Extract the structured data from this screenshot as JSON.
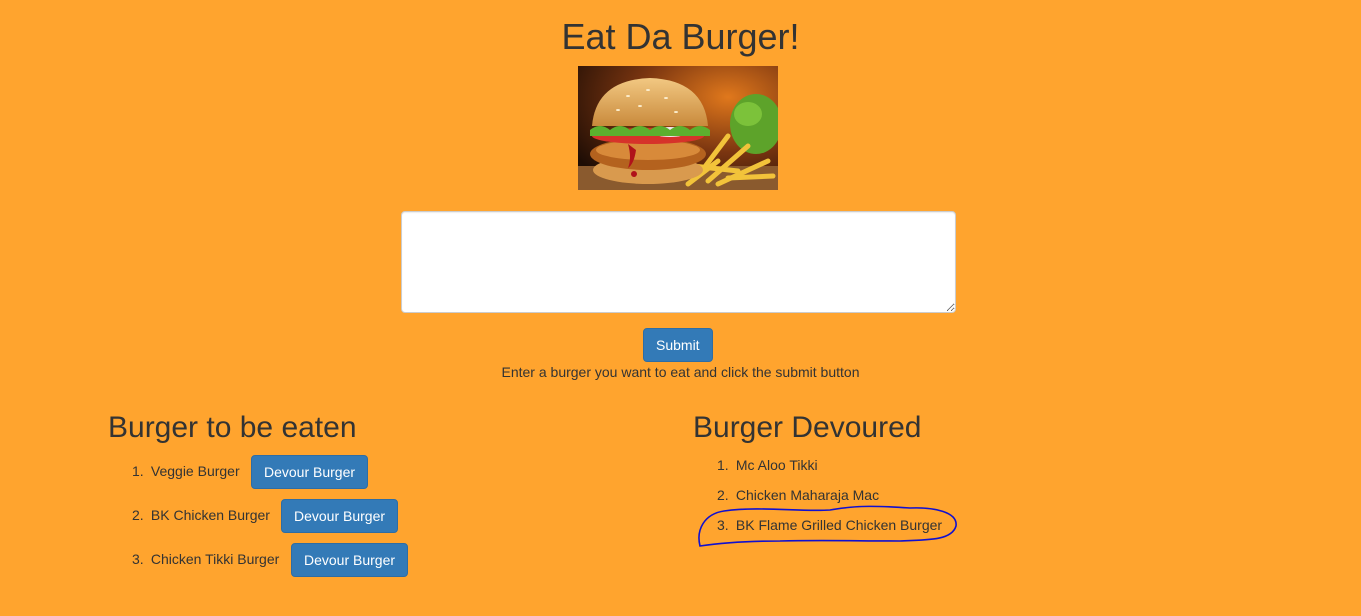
{
  "header": {
    "title": "Eat Da Burger!"
  },
  "hero_image": {
    "alt": "burger with fries",
    "icon": "burger-photo"
  },
  "form": {
    "textarea_value": "",
    "submit_label": "Submit",
    "help_text": "Enter a burger you want to eat and click the submit button"
  },
  "to_be_eaten": {
    "heading": "Burger to be eaten",
    "items": [
      {
        "num": "1.",
        "name": "Veggie Burger",
        "button": "Devour Burger"
      },
      {
        "num": "2.",
        "name": "BK Chicken Burger",
        "button": "Devour Burger"
      },
      {
        "num": "3.",
        "name": "Chicken Tikki Burger",
        "button": "Devour Burger"
      }
    ]
  },
  "devoured": {
    "heading": "Burger Devoured",
    "items": [
      {
        "num": "1.",
        "name": "Mc Aloo Tikki"
      },
      {
        "num": "2.",
        "name": "Chicken Maharaja Mac"
      },
      {
        "num": "3.",
        "name": "BK Flame Grilled Chicken Burger"
      }
    ]
  },
  "colors": {
    "background": "#FFA42E",
    "button": "#337ab7",
    "annotation": "#1010d0"
  }
}
